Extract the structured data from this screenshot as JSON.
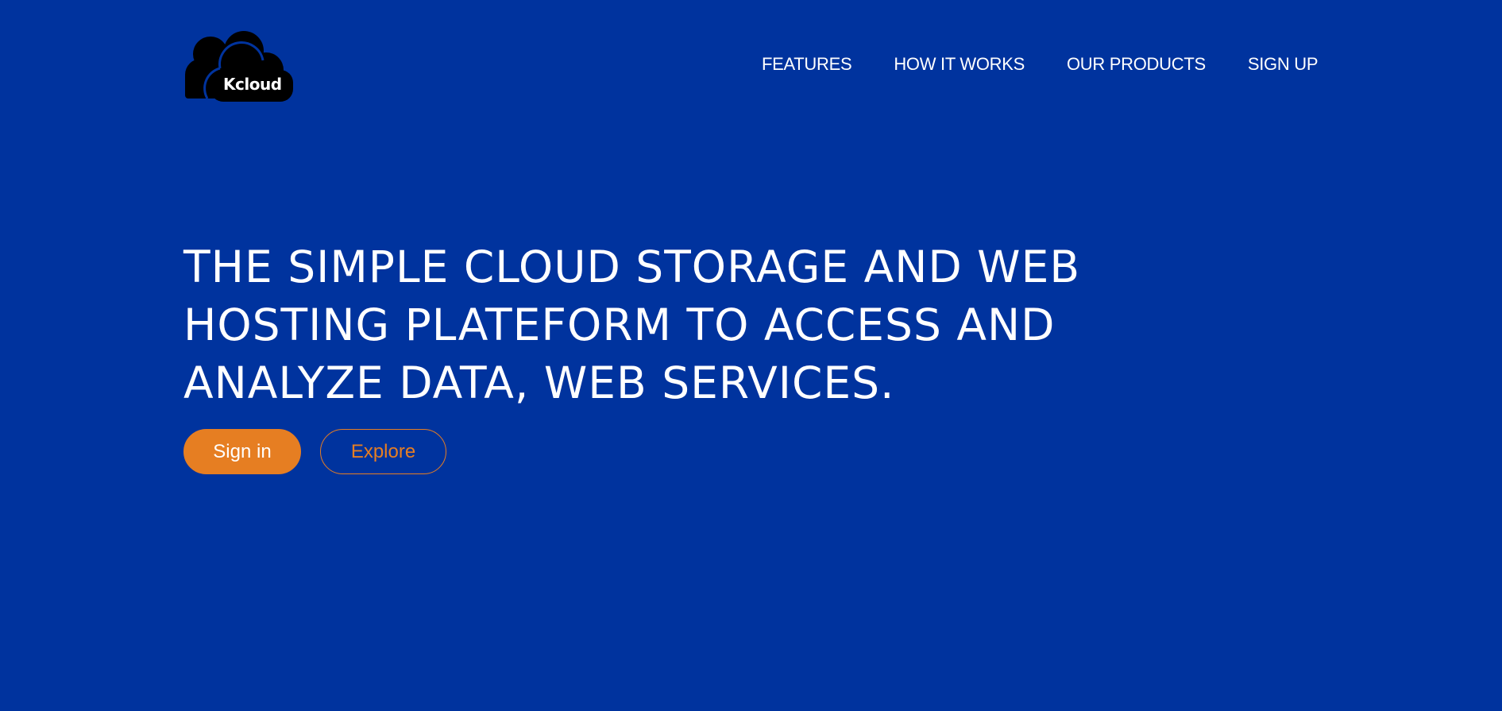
{
  "brand": {
    "logo_text": "Kcloud",
    "logo_icon": "cloud-icon"
  },
  "nav": {
    "items": [
      {
        "label": "FEATURES"
      },
      {
        "label": "HOW IT WORKS"
      },
      {
        "label": "OUR PRODUCTS"
      },
      {
        "label": "SIGN UP"
      }
    ]
  },
  "hero": {
    "title_lines": [
      "THE SIMPLE CLOUD STORAGE AND WEB",
      "HOSTING PLATEFORM TO ACCESS AND",
      "ANALYZE DATA, WEB SERVICES."
    ],
    "primary_button": "Sign in",
    "secondary_button": "Explore"
  },
  "colors": {
    "background": "#00339e",
    "accent": "#e67e22",
    "text": "#ffffff",
    "logo": "#000000"
  }
}
